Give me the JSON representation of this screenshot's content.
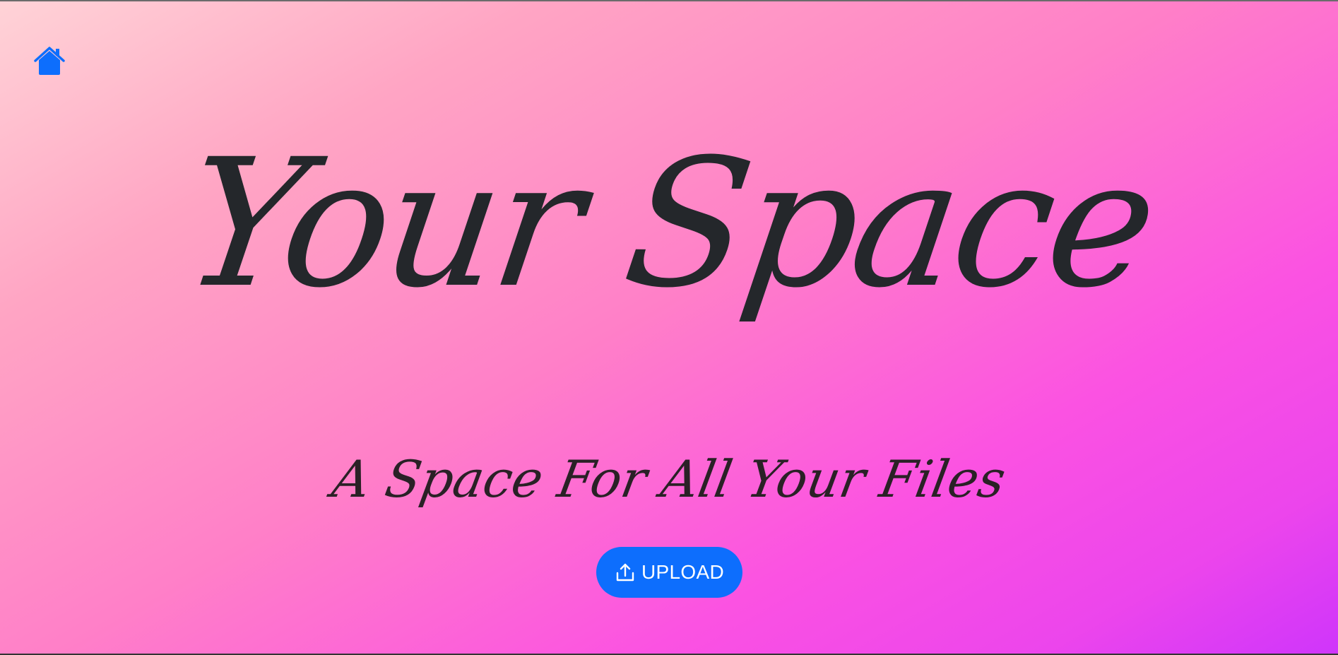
{
  "header": {
    "home_icon": "home-icon"
  },
  "hero": {
    "title": "Your Space",
    "subtitle": "A Space For All Your Files"
  },
  "actions": {
    "upload_label": "UPLOAD",
    "upload_icon": "upload-icon"
  },
  "colors": {
    "accent": "#0d6efd",
    "text": "#24272b",
    "gradient_start": "#ffd3d7",
    "gradient_end": "#cf35fb"
  }
}
